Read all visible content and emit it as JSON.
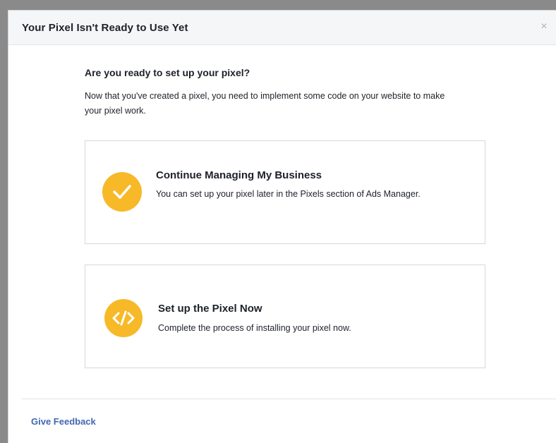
{
  "dialog": {
    "title": "Your Pixel Isn't Ready to Use Yet",
    "close_symbol": "×"
  },
  "main": {
    "heading": "Are you ready to set up your pixel?",
    "description": "Now that you've created a pixel, you need to implement some code on your website to make your pixel work."
  },
  "options": [
    {
      "title": "Continue Managing My Business",
      "description": "You can set up your pixel later in the Pixels section of Ads Manager.",
      "icon": "checkmark-icon"
    },
    {
      "title": "Set up the Pixel Now",
      "description": "Complete the process of installing your pixel now.",
      "icon": "code-icon"
    }
  ],
  "footer": {
    "feedback_label": "Give Feedback"
  },
  "colors": {
    "accent_yellow": "#f7b928",
    "link_blue": "#4267b2",
    "text_dark": "#1d2129"
  }
}
